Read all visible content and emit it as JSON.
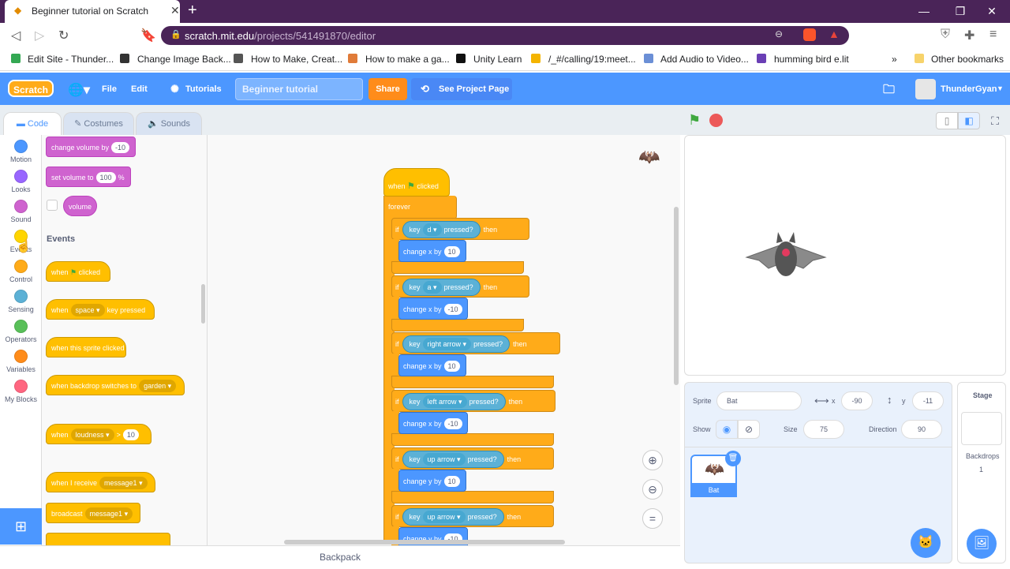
{
  "browser": {
    "tab_title": "Beginner tutorial on Scratch",
    "url_host": "scratch.mit.edu",
    "url_path": "/projects/541491870/editor",
    "bookmarks": [
      "Edit Site - Thunder...",
      "Change Image Back...",
      "How to Make, Creat...",
      "How to make a ga...",
      "Unity Learn",
      "/_#/calling/19:meet...",
      "Add Audio to Video...",
      "humming bird e.lit"
    ],
    "bookmarks_more": "»",
    "other_bookmarks": "Other bookmarks"
  },
  "menu": {
    "logo": "Scratch",
    "file": "File",
    "edit": "Edit",
    "tutorials": "Tutorials",
    "project_title": "Beginner tutorial",
    "share": "Share",
    "see_project_page": "See Project Page",
    "username": "ThunderGyan"
  },
  "tabs": {
    "code": "Code",
    "costumes": "Costumes",
    "sounds": "Sounds"
  },
  "categories": [
    {
      "label": "Motion",
      "color": "#4c97ff"
    },
    {
      "label": "Looks",
      "color": "#9966ff"
    },
    {
      "label": "Sound",
      "color": "#cf63cf"
    },
    {
      "label": "Events",
      "color": "#ffd500"
    },
    {
      "label": "Control",
      "color": "#ffab19"
    },
    {
      "label": "Sensing",
      "color": "#5cb1d6"
    },
    {
      "label": "Operators",
      "color": "#59c059"
    },
    {
      "label": "Variables",
      "color": "#ff8c1a"
    },
    {
      "label": "My Blocks",
      "color": "#ff6680"
    }
  ],
  "palette": {
    "change_volume": "change volume by",
    "change_volume_val": "-10",
    "set_volume": "set volume to",
    "set_volume_val": "100",
    "set_volume_unit": "%",
    "volume": "volume",
    "events_heading": "Events",
    "when": "when",
    "clicked": "clicked",
    "key_pressed_pre": "when",
    "key_pressed_key": "space",
    "key_pressed_post": "key pressed",
    "sprite_clicked": "when this sprite clicked",
    "backdrop_switches": "when backdrop switches to",
    "backdrop_val": "garden",
    "loudness_when": "when",
    "loudness": "loudness",
    "gt": ">",
    "loudness_val": "10",
    "receive": "when I receive",
    "message": "message1",
    "broadcast": "broadcast",
    "broadcast_msg": "message1"
  },
  "script": {
    "hat_when": "when",
    "hat_clicked": "clicked",
    "forever": "forever",
    "if": "if",
    "then": "then",
    "key": "key",
    "pressed": "pressed?",
    "rows": [
      {
        "key": "d",
        "action": "change x by",
        "value": "10"
      },
      {
        "key": "a",
        "action": "change x by",
        "value": "-10"
      },
      {
        "key": "right arrow",
        "action": "change x by",
        "value": "10"
      },
      {
        "key": "left arrow",
        "action": "change x by",
        "value": "-10"
      },
      {
        "key": "up arrow",
        "action": "change y by",
        "value": "10"
      },
      {
        "key": "up arrow",
        "action": "change y by",
        "value": "-10"
      }
    ]
  },
  "workspace": {
    "backpack": "Backpack"
  },
  "sprite_info": {
    "sprite_label": "Sprite",
    "sprite_name": "Bat",
    "x_label": "x",
    "x": "-90",
    "y_label": "y",
    "y": "-11",
    "show_label": "Show",
    "size_label": "Size",
    "size": "75",
    "direction_label": "Direction",
    "direction": "90",
    "thumb_name": "Bat"
  },
  "stage_pane": {
    "title": "Stage",
    "backdrops_label": "Backdrops",
    "backdrops_count": "1"
  }
}
